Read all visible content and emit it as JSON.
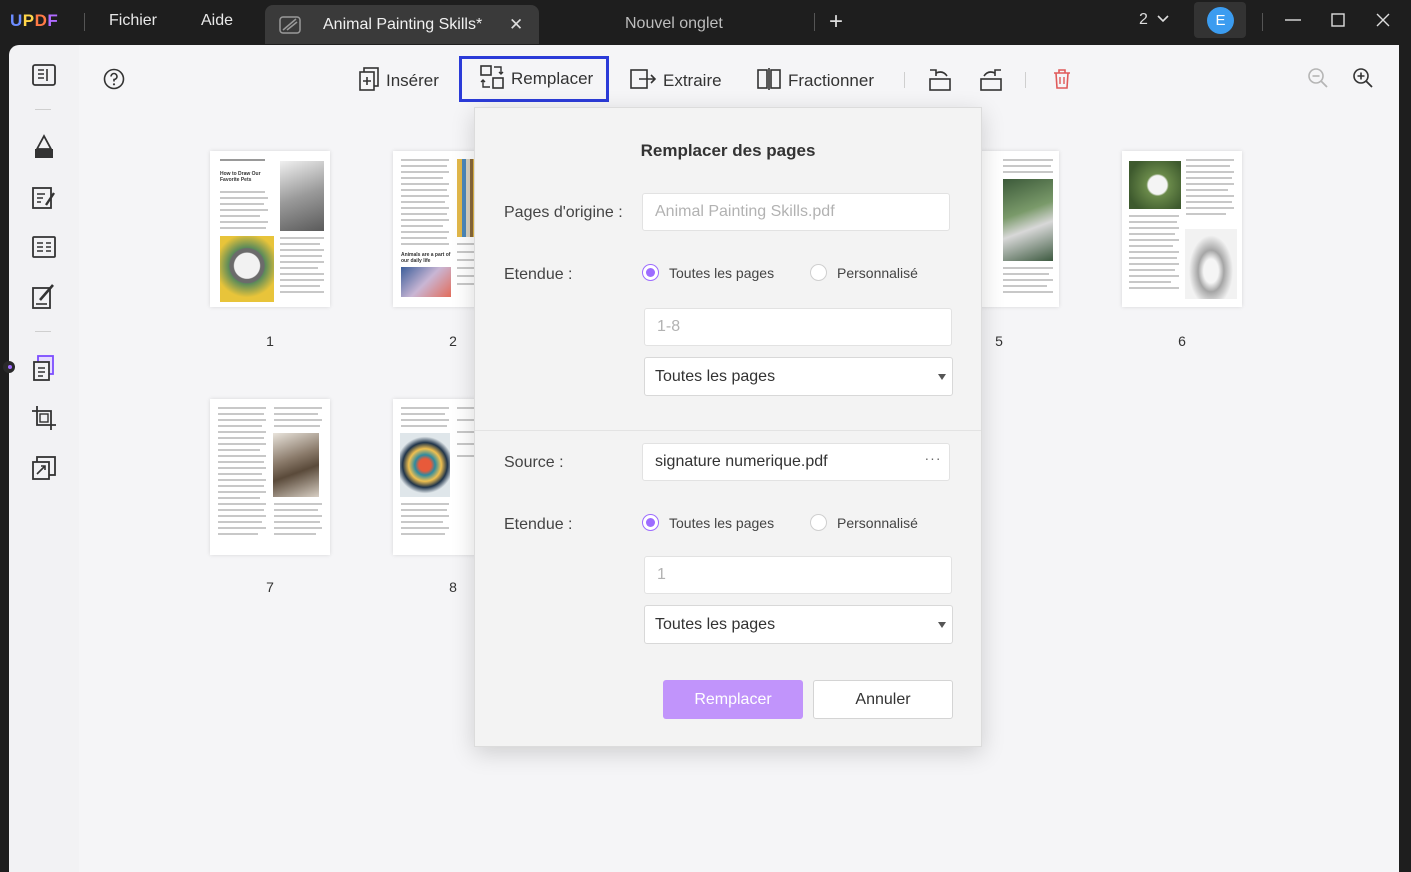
{
  "app": {
    "brand": "UPDF"
  },
  "menu": {
    "file": "Fichier",
    "help": "Aide"
  },
  "tabs": {
    "active": "Animal Painting Skills*",
    "new": "Nouvel onglet"
  },
  "window": {
    "count": "2",
    "avatar": "E"
  },
  "toolbar": {
    "insert": "Insérer",
    "replace": "Remplacer",
    "extract": "Extraire",
    "split": "Fractionner"
  },
  "pages": [
    {
      "number": "1"
    },
    {
      "number": "2"
    },
    {
      "number": "5"
    },
    {
      "number": "6"
    },
    {
      "number": "7"
    },
    {
      "number": "8"
    }
  ],
  "page1": {
    "heading": "How to Draw Our Favorite Pets"
  },
  "page2": {
    "heading": "Animals are a part of our daily life"
  },
  "dialog": {
    "title": "Remplacer des pages",
    "origin_label": "Pages d'origine :",
    "origin_file": "Animal Painting Skills.pdf",
    "range_label": "Etendue :",
    "all_pages": "Toutes les pages",
    "custom": "Personnalisé",
    "origin_range_placeholder": "1-8",
    "origin_select": "Toutes les pages",
    "source_label": "Source :",
    "source_file": "signature numerique.pdf",
    "source_range_label": "Etendue :",
    "source_range_placeholder": "1",
    "source_select": "Toutes les pages",
    "replace_button": "Remplacer",
    "cancel_button": "Annuler"
  },
  "colors": {
    "accent": "#9d6cff",
    "primary_button": "#c194fb",
    "highlight_border": "#2b3bd8",
    "delete": "#e05a5a"
  }
}
